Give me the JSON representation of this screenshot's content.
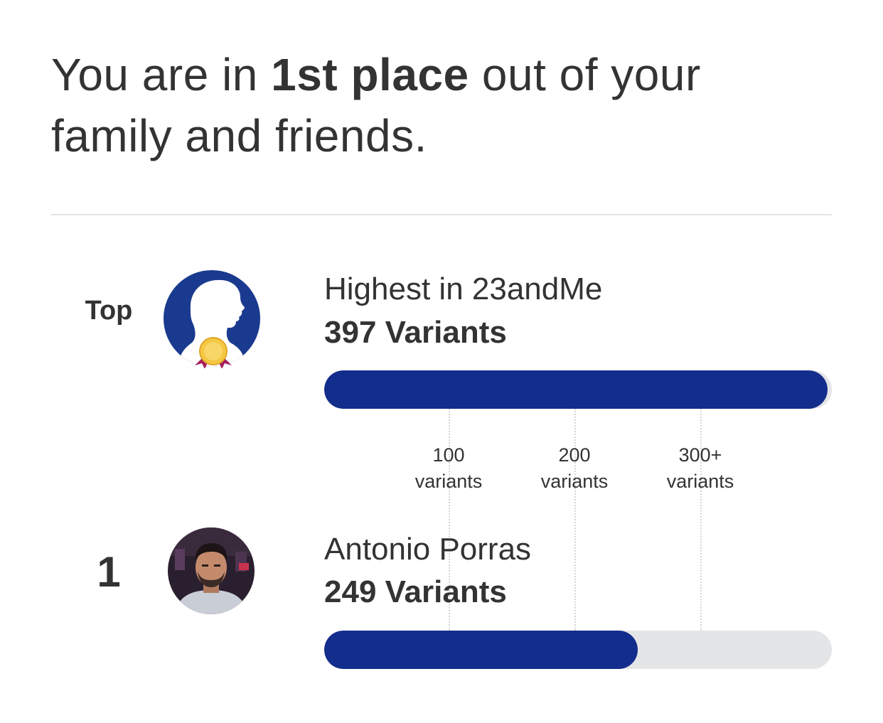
{
  "headline": {
    "prefix": "You are in ",
    "emphasis": "1st place",
    "suffix": " out of your family and friends."
  },
  "leaderboard": {
    "max_variants": 397,
    "ticks": [
      {
        "value_label": "100",
        "unit_label": "variants",
        "value": 100
      },
      {
        "value_label": "200",
        "unit_label": "variants",
        "value": 200
      },
      {
        "value_label": "300+",
        "unit_label": "variants",
        "value": 300
      }
    ],
    "rows": [
      {
        "rank_label": "Top",
        "name": "Highest in 23andMe",
        "count_label": "397 Variants",
        "variants": 397,
        "avatar_icon": "medal-silhouette-icon"
      },
      {
        "rank_label": "1",
        "name": "Antonio Porras",
        "count_label": "249 Variants",
        "variants": 249,
        "avatar_icon": "user-photo"
      }
    ]
  },
  "colors": {
    "bar_fill": "#132d8c",
    "bar_track": "#e4e5e7",
    "avatar_blue": "#1a3a8f",
    "medal_gold": "#f5c842",
    "ribbon": "#a61e5a"
  }
}
